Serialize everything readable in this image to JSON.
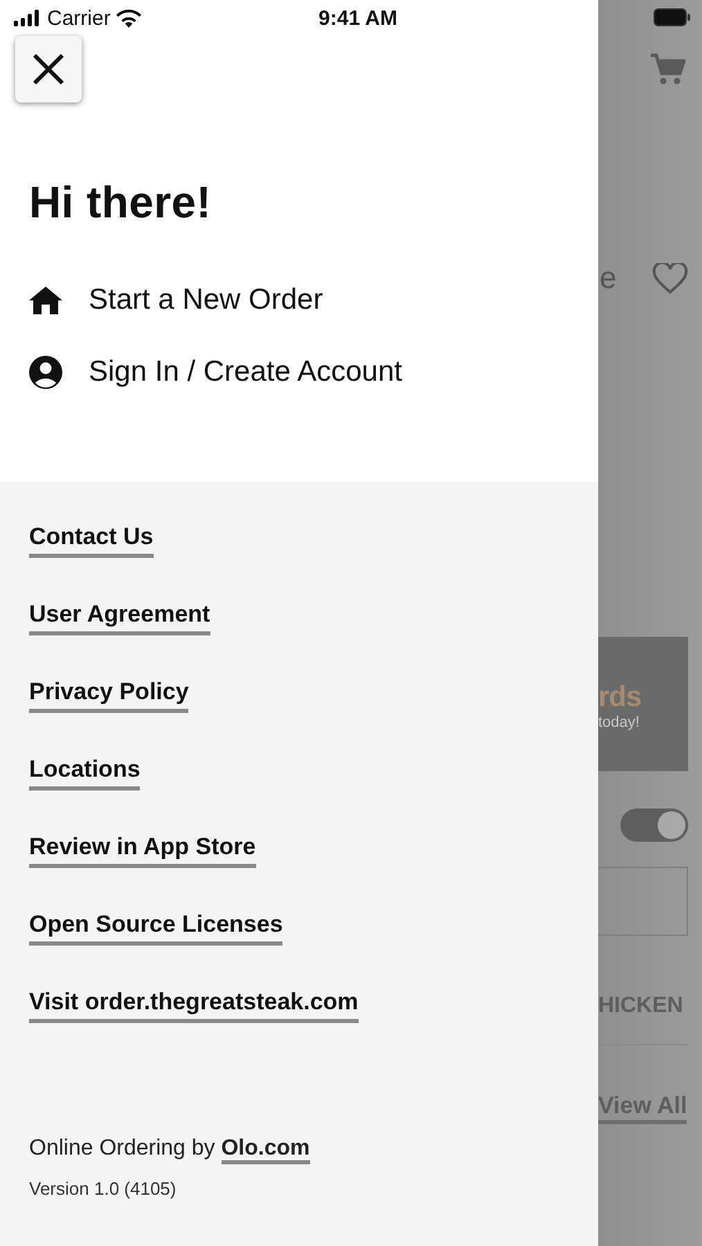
{
  "status_bar": {
    "carrier": "Carrier",
    "time": "9:41 AM"
  },
  "drawer": {
    "greeting": "Hi there!",
    "actions": [
      {
        "kind": "home",
        "label": "Start a New Order"
      },
      {
        "kind": "account",
        "label": "Sign In / Create Account"
      }
    ],
    "links": [
      "Contact Us",
      "User Agreement",
      "Privacy Policy",
      "Locations",
      "Review in App Store",
      "Open Source Licenses",
      "Visit order.thegreatsteak.com"
    ],
    "footer": {
      "text": "Online Ordering by",
      "link": "Olo.com",
      "version": "Version 1.0 (4105)"
    }
  },
  "background_screen": {
    "fragment": "e",
    "banner_title": "rds",
    "banner_subtitle": "today!",
    "toggle": {
      "on": true
    },
    "category": "HICKEN",
    "view_all": "View All"
  }
}
